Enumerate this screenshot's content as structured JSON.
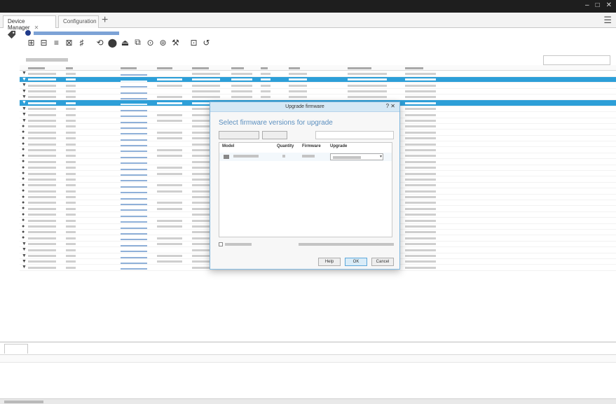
{
  "window": {
    "title": "",
    "controls": [
      "–",
      "□",
      "✕"
    ]
  },
  "tabs": [
    {
      "label": "Device Manager",
      "active": true,
      "closable": true
    },
    {
      "label": "Configuration",
      "active": false,
      "closable": false
    }
  ],
  "tab_add_label": "+",
  "menu_icon": "hamburger-menu-icon",
  "notice": {
    "icon": "info-icon",
    "link_text": ""
  },
  "toolbar": {
    "icons": [
      "discover-icon",
      "identify-icon",
      "set-ip-icon",
      "restart-icon",
      "settings-icon",
      "refresh-icon",
      "upgrade-firmware-icon",
      "install-icon",
      "backup-icon",
      "restore-icon",
      "users-icon",
      "tools-icon",
      "assign-icon",
      "history-icon"
    ]
  },
  "devices_count_text": "",
  "search": {
    "placeholder": "",
    "value": ""
  },
  "table": {
    "columns": [
      "",
      "",
      "",
      "",
      "",
      "",
      "",
      "",
      "",
      "",
      ""
    ],
    "row_count": 34,
    "selected_rows": [
      1,
      5
    ]
  },
  "dialog": {
    "title": "Upgrade firmware",
    "title_controls": [
      "?",
      "✕"
    ],
    "heading": "Select firmware versions for upgrade",
    "check_updates_label": "",
    "browse_label": "",
    "search_placeholder": "",
    "columns": [
      "Model",
      "Quantity",
      "Firmware",
      "Upgrade"
    ],
    "rows": [
      {
        "model": "",
        "quantity": "",
        "firmware": "",
        "upgrade": ""
      }
    ],
    "select_label": "",
    "latest_check_text": "",
    "buttons": {
      "help": "Help",
      "ok": "OK",
      "cancel": "Cancel"
    }
  },
  "bottom_panel": {
    "tabs": [
      "",
      ""
    ],
    "columns": [
      "",
      "",
      ""
    ]
  },
  "status_text": "",
  "colors": {
    "selection": "#2d9fd8",
    "titlebar": "#1e1e1e",
    "dialog_border": "#7fb7de",
    "dialog_heading": "#5b8fbf"
  }
}
